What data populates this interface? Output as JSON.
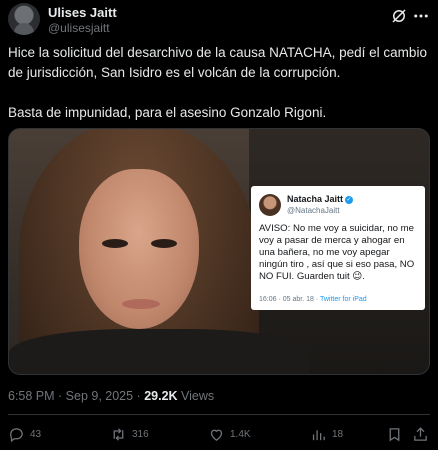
{
  "author": {
    "name": "Ulises Jaitt",
    "handle": "@ulisesjaitt"
  },
  "icons": {
    "grok": "grok-icon",
    "more": "more-icon",
    "reply": "reply-icon",
    "retweet": "retweet-icon",
    "like": "like-icon",
    "views": "views-icon",
    "bookmark": "bookmark-icon",
    "share": "share-icon"
  },
  "tweet": {
    "paragraph1": "Hice la solicitud del desarchivo de la causa NATACHA, pedí el cambio de jurisdicción, San Isidro es el volcán de la corrupción.",
    "paragraph2": "Basta de impunidad, para el asesino Gonzalo Rigoni."
  },
  "embedded_card": {
    "name": "Natacha Jaitt",
    "handle": "@NatachaJaitt",
    "text": "AVISO: No me voy a suicidar, no me voy a pasar de merca y ahogar en una bañera, no me voy apegar ningún tiro , así que si eso pasa, NO NO FUI. Guarden tuit 😉.",
    "timestamp": "16:06 · 05 abr. 18 · ",
    "via": "Twitter for iPad"
  },
  "meta": {
    "time": "6:58 PM · Sep 9, 2025 · ",
    "views_count": "29.2K",
    "views_label": " Views"
  },
  "actions": {
    "replies": "43",
    "retweets": "316",
    "likes": "1.4K",
    "views": "18"
  },
  "colors": {
    "background": "#000000",
    "text": "#e7e9ea",
    "muted": "#71767b",
    "accent": "#1d9bf0",
    "divider": "#2f3336"
  }
}
